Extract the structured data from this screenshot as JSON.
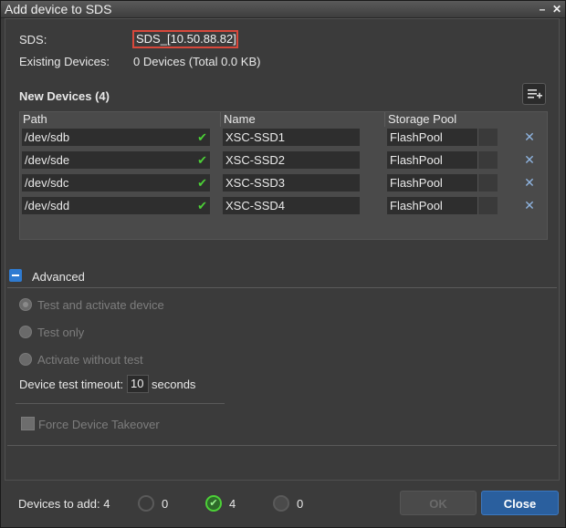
{
  "window": {
    "title": "Add device to SDS"
  },
  "sds": {
    "label": "SDS:",
    "value": "SDS_[10.50.88.82]"
  },
  "existing": {
    "label": "Existing Devices:",
    "value": "0 Devices (Total 0.0 KB)"
  },
  "new_devices": {
    "heading": "New Devices (4)",
    "columns": [
      "Path",
      "Name",
      "Storage Pool"
    ],
    "rows": [
      {
        "path": "/dev/sdb",
        "name": "XSC-SSD1",
        "pool": "FlashPool"
      },
      {
        "path": "/dev/sde",
        "name": "XSC-SSD2",
        "pool": "FlashPool"
      },
      {
        "path": "/dev/sdc",
        "name": "XSC-SSD3",
        "pool": "FlashPool"
      },
      {
        "path": "/dev/sdd",
        "name": "XSC-SSD4",
        "pool": "FlashPool"
      }
    ]
  },
  "advanced": {
    "label": "Advanced",
    "options": [
      "Test and activate device",
      "Test only",
      "Activate without test"
    ],
    "selected": "Test and activate device",
    "timeout_label": "Device test timeout:",
    "timeout_value": "10",
    "timeout_unit": "seconds",
    "force_takeover": "Force Device Takeover"
  },
  "footer": {
    "devices_to_add": "Devices to add: 4",
    "pending_count": "0",
    "success_count": "4",
    "failed_count": "0",
    "ok_label": "OK",
    "close_label": "Close"
  },
  "colors": {
    "accent": "#2f7bd1",
    "check": "#4cd137",
    "highlight": "#d9483b"
  }
}
